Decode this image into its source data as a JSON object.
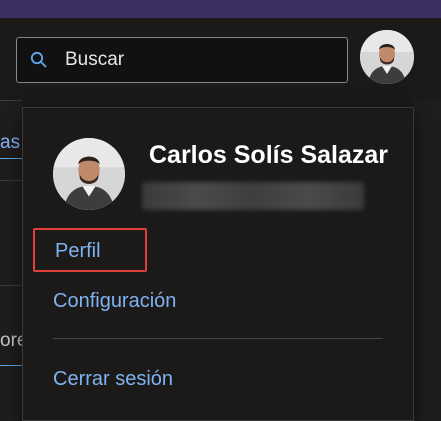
{
  "search": {
    "placeholder": "Buscar",
    "value": ""
  },
  "profile_menu": {
    "user_name": "Carlos Solís Salazar",
    "items": [
      {
        "label": "Perfil"
      },
      {
        "label": "Configuración"
      },
      {
        "label": "Cerrar sesión"
      }
    ]
  },
  "background": {
    "snippets": [
      "as",
      "ore"
    ]
  },
  "colors": {
    "accent": "#7fb2f0",
    "highlight_border": "#e0403a",
    "top_strip": "#3b2f63"
  },
  "icons": {
    "search": "search-icon",
    "avatar": "user-avatar"
  }
}
